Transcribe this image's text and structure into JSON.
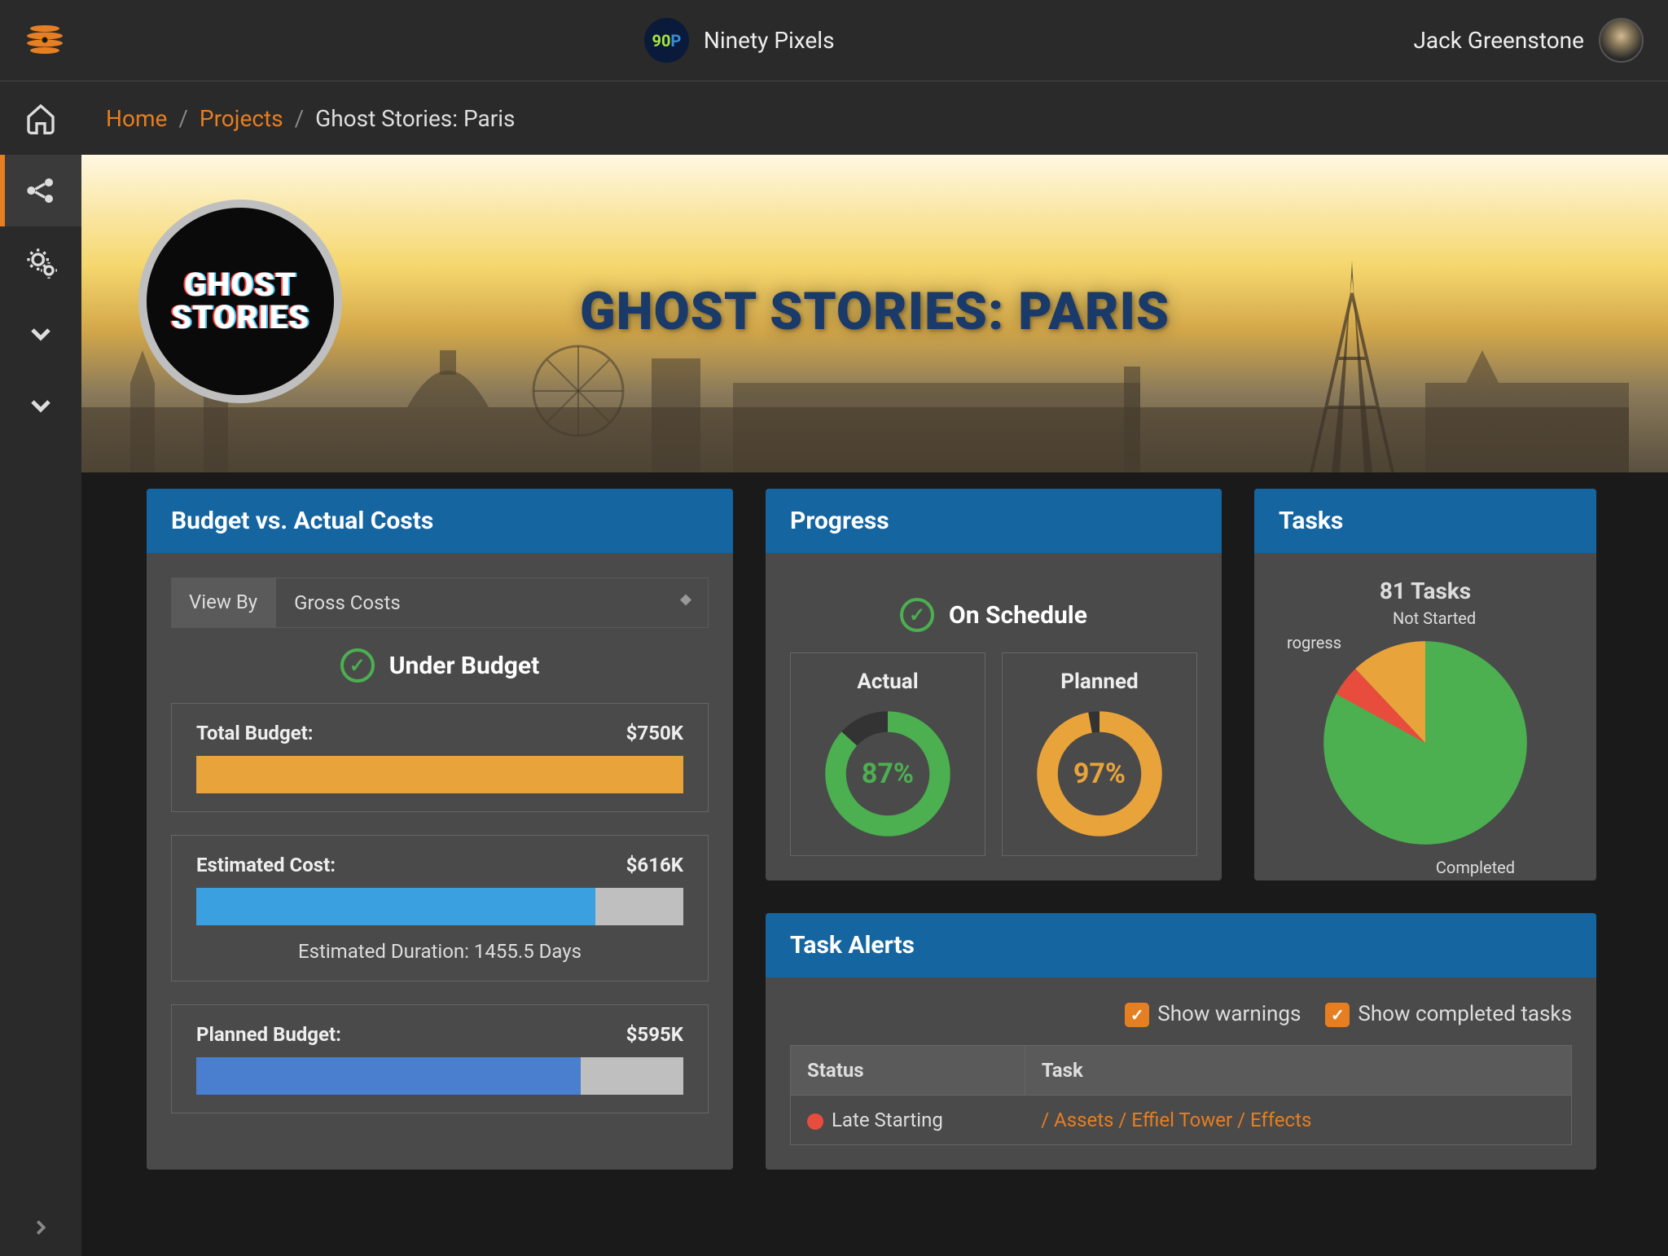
{
  "header": {
    "org_code_left": "90",
    "org_code_right": "P",
    "org_name": "Ninety Pixels",
    "user_name": "Jack Greenstone"
  },
  "breadcrumb": {
    "home": "Home",
    "projects": "Projects",
    "current": "Ghost Stories: Paris"
  },
  "hero": {
    "badge_line1": "GHOST",
    "badge_line2": "STORIES",
    "title": "GHOST STORIES: PARIS"
  },
  "budget": {
    "panel_title": "Budget vs. Actual Costs",
    "view_by_label": "View By",
    "view_by_value": "Gross Costs",
    "status": "Under Budget",
    "total_label": "Total Budget:",
    "total_value": "$750K",
    "estimated_label": "Estimated Cost:",
    "estimated_value": "$616K",
    "estimated_duration": "Estimated Duration: 1455.5 Days",
    "planned_label": "Planned Budget:",
    "planned_value": "$595K"
  },
  "progress": {
    "panel_title": "Progress",
    "status": "On Schedule",
    "actual_label": "Actual",
    "actual_pct": "87%",
    "planned_label": "Planned",
    "planned_pct": "97%"
  },
  "tasks": {
    "panel_title": "Tasks",
    "summary": "81 Tasks",
    "label_not_started": "Not Started",
    "label_in_progress": "rogress",
    "label_completed": "Completed"
  },
  "alerts": {
    "panel_title": "Task Alerts",
    "show_warnings": "Show warnings",
    "show_completed": "Show completed tasks",
    "col_status": "Status",
    "col_task": "Task",
    "rows": [
      {
        "status": "Late Starting",
        "status_color": "#e74c3c",
        "task": "/ Assets / Effiel Tower / Effects"
      }
    ]
  },
  "chart_data": [
    {
      "type": "bar",
      "title": "Budget vs. Actual Costs",
      "series": [
        {
          "name": "Total Budget",
          "values": [
            750
          ],
          "fill_pct": 100,
          "color": "#e8a33a"
        },
        {
          "name": "Estimated Cost",
          "values": [
            616
          ],
          "fill_pct": 82,
          "color": "#3aa0e0"
        },
        {
          "name": "Planned Budget",
          "values": [
            595
          ],
          "fill_pct": 79,
          "color": "#4a7fd0"
        }
      ],
      "unit": "$K"
    },
    {
      "type": "pie",
      "title": "Progress Actual",
      "series": [
        {
          "name": "Actual",
          "values": [
            87
          ]
        }
      ],
      "unit": "%",
      "color": "#4caf50"
    },
    {
      "type": "pie",
      "title": "Progress Planned",
      "series": [
        {
          "name": "Planned",
          "values": [
            97
          ]
        }
      ],
      "unit": "%",
      "color": "#e8a33a"
    },
    {
      "type": "pie",
      "title": "Tasks",
      "categories": [
        "Completed",
        "Not Started",
        "In Progress"
      ],
      "values": [
        69,
        8,
        4
      ],
      "colors": [
        "#4caf50",
        "#e8a33a",
        "#e74c3c"
      ],
      "total": 81
    }
  ]
}
